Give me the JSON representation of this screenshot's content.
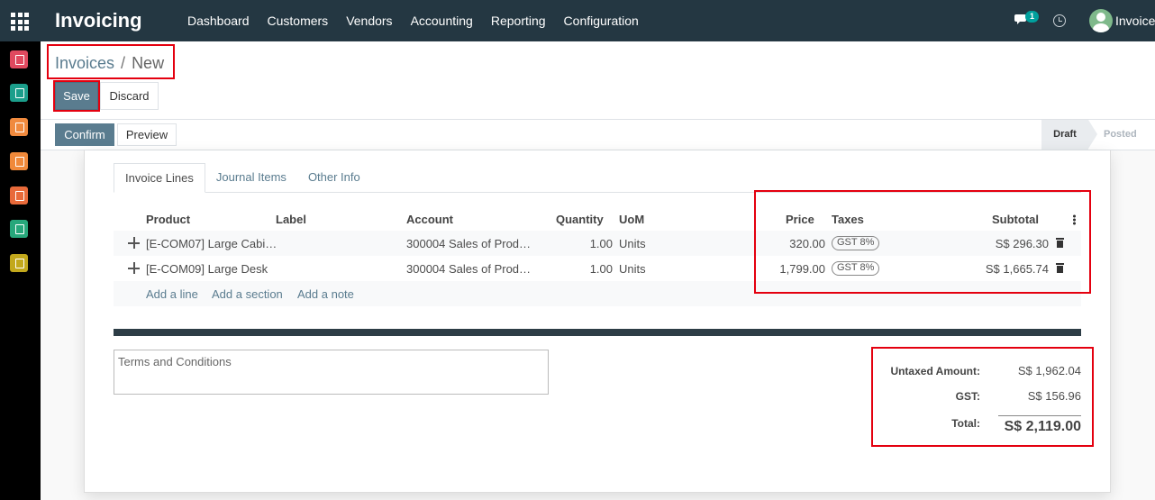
{
  "navbar": {
    "brand": "Invoicing",
    "menu": [
      "Dashboard",
      "Customers",
      "Vendors",
      "Accounting",
      "Reporting",
      "Configuration"
    ],
    "chat_count": "1",
    "user_name": "Invoice"
  },
  "sidebar": {
    "apps": [
      {
        "icon": "discuss-icon",
        "color": "#e0495f"
      },
      {
        "icon": "contacts-icon",
        "color": "#1b9e8b"
      },
      {
        "icon": "dashboards-icon",
        "color": "#f08a3e"
      },
      {
        "icon": "website-icon",
        "color": "#f0893a"
      },
      {
        "icon": "invoicing-icon",
        "color": "#e86a3a"
      },
      {
        "icon": "documents-icon",
        "color": "#27a77b"
      },
      {
        "icon": "settings-icon",
        "color": "#c2a81c"
      }
    ]
  },
  "breadcrumb": {
    "parent": "Invoices",
    "separator": "/",
    "current": "New"
  },
  "actions": {
    "save": "Save",
    "discard": "Discard"
  },
  "status": {
    "confirm": "Confirm",
    "preview": "Preview",
    "stages": [
      "Draft",
      "Posted"
    ],
    "current_stage": "Draft"
  },
  "tabs": [
    "Invoice Lines",
    "Journal Items",
    "Other Info"
  ],
  "lines": {
    "columns": {
      "product": "Product",
      "label": "Label",
      "account": "Account",
      "quantity": "Quantity",
      "uom": "UoM",
      "price": "Price",
      "taxes": "Taxes",
      "subtotal": "Subtotal"
    },
    "rows": [
      {
        "product": "[E-COM07] Large Cabi…",
        "label": "",
        "account": "300004 Sales of Prod…",
        "quantity": "1.00",
        "uom": "Units",
        "price": "320.00",
        "tax": "GST 8%",
        "subtotal": "S$ 296.30"
      },
      {
        "product": "[E-COM09] Large Desk",
        "label": "",
        "account": "300004 Sales of Prod…",
        "quantity": "1.00",
        "uom": "Units",
        "price": "1,799.00",
        "tax": "GST 8%",
        "subtotal": "S$ 1,665.74"
      }
    ],
    "add_line": "Add a line",
    "add_section": "Add a section",
    "add_note": "Add a note"
  },
  "terms_placeholder": "Terms and Conditions",
  "totals": {
    "untaxed_label": "Untaxed Amount:",
    "untaxed": "S$ 1,962.04",
    "gst_label": "GST:",
    "gst": "S$ 156.96",
    "total_label": "Total:",
    "total": "S$ 2,119.00"
  }
}
